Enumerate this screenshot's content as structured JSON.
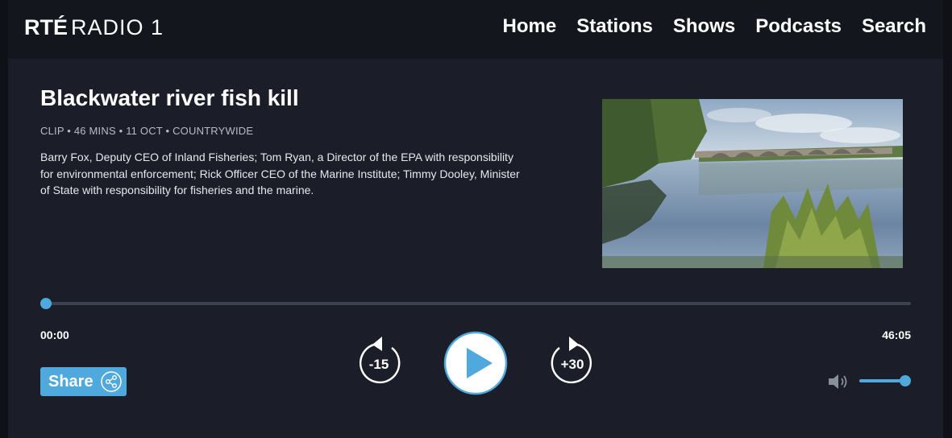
{
  "brand": {
    "rte": "RTÉ",
    "station": "RADIO 1"
  },
  "nav": {
    "items": [
      {
        "label": "Home"
      },
      {
        "label": "Stations"
      },
      {
        "label": "Shows"
      },
      {
        "label": "Podcasts"
      },
      {
        "label": "Search"
      }
    ]
  },
  "clip": {
    "title": "Blackwater river fish kill",
    "meta": "CLIP • 46 MINS • 11 OCT • COUNTRYWIDE",
    "description": "Barry Fox, Deputy CEO of Inland Fisheries; Tom Ryan, a Director of the EPA with responsibility for environmental enforcement; Rick Officer CEO of the Marine Institute; Timmy Dooley, Minister of State with responsibility for fisheries and the marine."
  },
  "player": {
    "current_time": "00:00",
    "duration": "46:05",
    "progress_fraction": 0.0,
    "rewind_label": "-15",
    "forward_label": "+30",
    "share_label": "Share",
    "volume_fraction": 1.0
  },
  "colors": {
    "accent": "#4fa9dd",
    "background": "#1b1e28",
    "header": "#14161d"
  }
}
